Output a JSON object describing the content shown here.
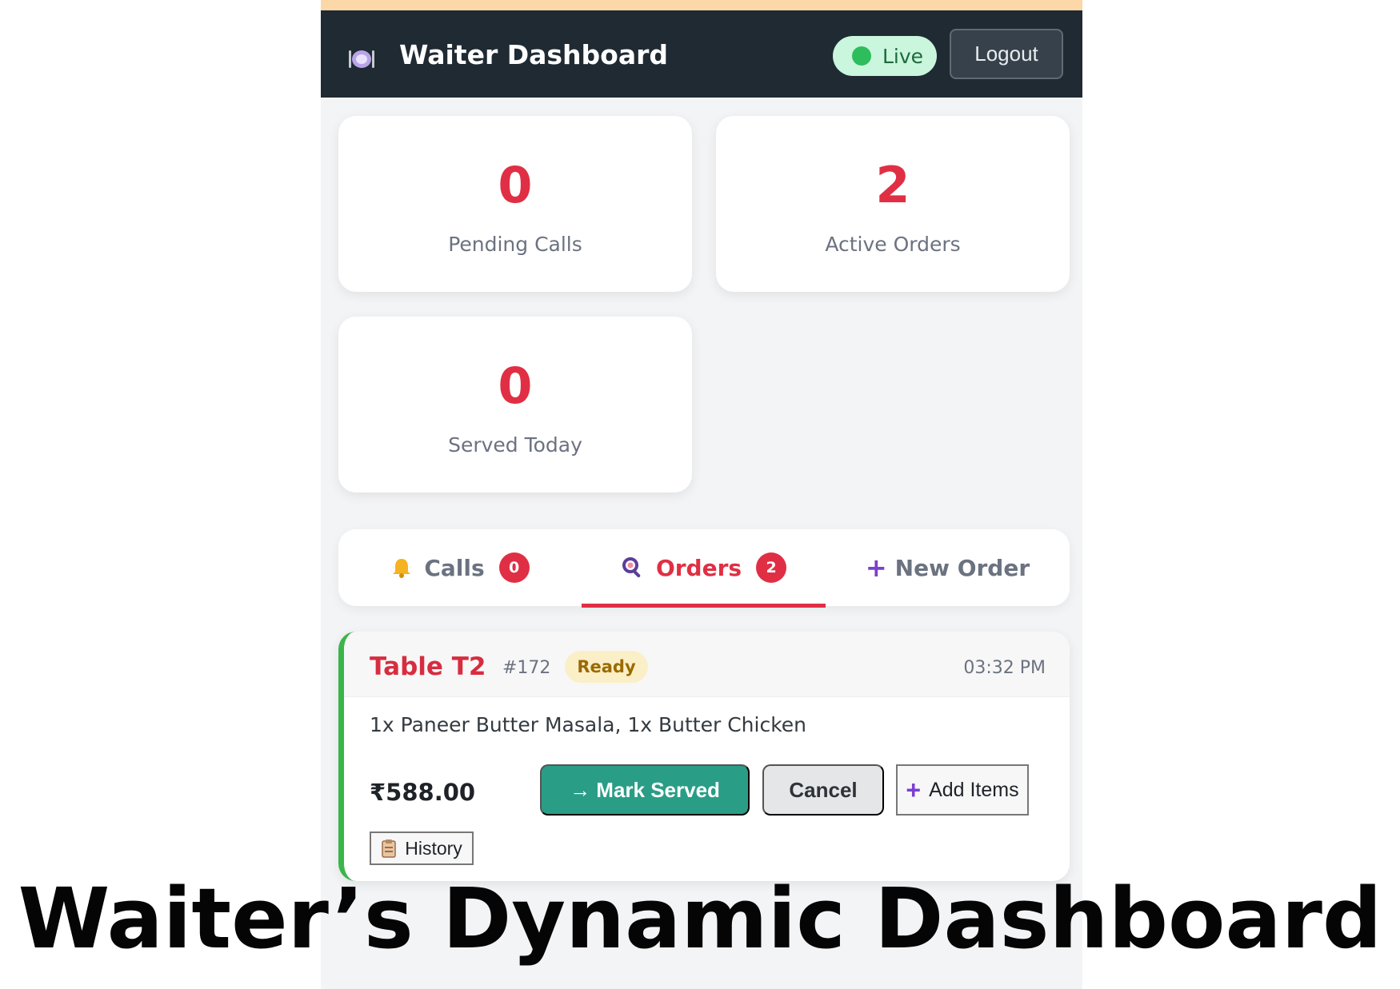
{
  "app": {
    "title": "Waiter Dashboard",
    "status": "Live",
    "logout_label": "Logout",
    "colors": {
      "header_bg": "#1f2a33",
      "accent_red": "#e02f44",
      "live_green": "#2ebd5c",
      "served_teal": "#2a9d86"
    }
  },
  "stats": {
    "pending_calls": {
      "value": "0",
      "label": "Pending Calls"
    },
    "active_orders": {
      "value": "2",
      "label": "Active Orders"
    },
    "served_today": {
      "value": "0",
      "label": "Served Today"
    }
  },
  "tabs": {
    "calls": {
      "label": "Calls",
      "count": "0",
      "icon": "bell-icon"
    },
    "orders": {
      "label": "Orders",
      "count": "2",
      "icon": "magnifier-icon",
      "active": true
    },
    "new_order": {
      "label": "New Order",
      "icon": "plus-icon"
    }
  },
  "order": {
    "table": "Table T2",
    "number": "#172",
    "status": "Ready",
    "time": "03:32 PM",
    "items": "1x Paneer Butter Masala, 1x Butter Chicken",
    "total": "₹588.00",
    "actions": {
      "mark_served": "→ Mark Served",
      "cancel": "Cancel",
      "add_items": "Add Items",
      "history": "History"
    }
  },
  "caption": "Waiter’s Dynamic Dashboard"
}
